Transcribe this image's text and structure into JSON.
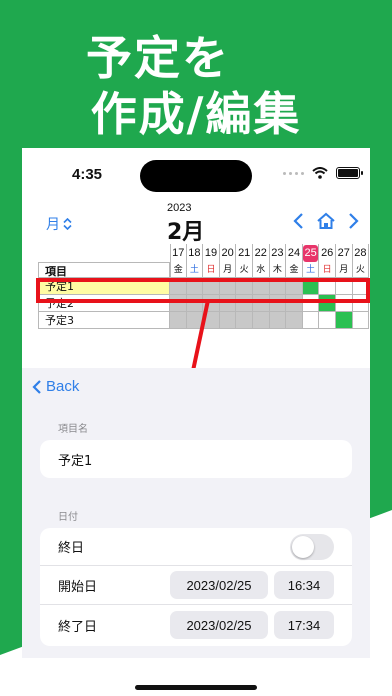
{
  "headline": {
    "line1": "予定を",
    "line2": "作成/編集"
  },
  "status": {
    "time": "4:35"
  },
  "calendar": {
    "view_selector": "月",
    "year": "2023",
    "month": "2月",
    "days": [
      "17",
      "18",
      "19",
      "20",
      "21",
      "22",
      "23",
      "24",
      "25",
      "26",
      "27",
      "28"
    ],
    "weekdays": [
      "金",
      "土",
      "日",
      "月",
      "火",
      "水",
      "木",
      "金",
      "土",
      "日",
      "月",
      "火"
    ],
    "today_index": 8,
    "item_header": "項目",
    "items": [
      {
        "name": "予定1",
        "green_days": [
          8
        ],
        "selected": true
      },
      {
        "name": "予定2",
        "green_days": [
          9
        ]
      },
      {
        "name": "予定3",
        "green_days": [
          10
        ]
      }
    ]
  },
  "form": {
    "back_label": "Back",
    "item_name_section": "項目名",
    "item_name_value": "予定1",
    "date_section": "日付",
    "all_day_label": "終日",
    "all_day_on": false,
    "start_label": "開始日",
    "start_date": "2023/02/25",
    "start_time": "16:34",
    "end_label": "終了日",
    "end_date": "2023/02/25",
    "end_time": "17:34"
  },
  "colors": {
    "green": "#1fa84e",
    "accent_blue": "#2f7fe8",
    "today_pink": "#e8356a",
    "highlight_red": "#e8121a"
  }
}
